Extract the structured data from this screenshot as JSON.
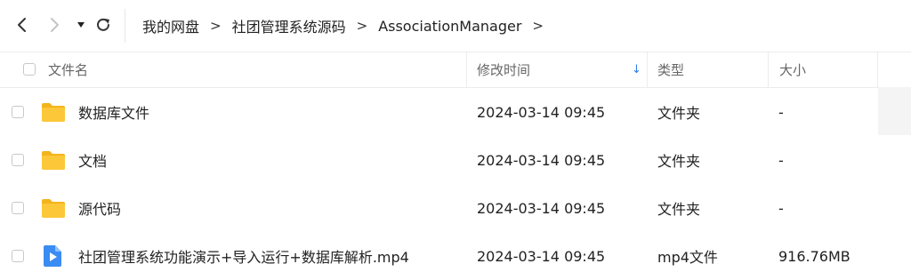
{
  "toolbar": {
    "icons": [
      "back-arrow-icon",
      "forward-arrow-icon",
      "dropdown-caret-icon",
      "refresh-icon"
    ]
  },
  "breadcrumb": {
    "items": [
      "我的网盘",
      "社团管理系统源码",
      "AssociationManager"
    ],
    "separator": ">"
  },
  "columns": {
    "name": "文件名",
    "modified": "修改时间",
    "type": "类型",
    "size": "大小",
    "sort_indicator": "↓"
  },
  "files": [
    {
      "name": "数据库文件",
      "modified": "2024-03-14 09:45",
      "type": "文件夹",
      "size": "-",
      "icon": "folder-icon"
    },
    {
      "name": "文档",
      "modified": "2024-03-14 09:45",
      "type": "文件夹",
      "size": "-",
      "icon": "folder-icon"
    },
    {
      "name": "源代码",
      "modified": "2024-03-14 09:45",
      "type": "文件夹",
      "size": "-",
      "icon": "folder-icon"
    },
    {
      "name": "社团管理系统功能演示+导入运行+数据库解析.mp4",
      "modified": "2024-03-14 09:45",
      "type": "mp4文件",
      "size": "916.76MB",
      "icon": "video-file-icon"
    }
  ],
  "colors": {
    "folder": "#f8c431",
    "video_icon": "#3a8bf2",
    "sort_accent": "#2f7ff0"
  }
}
